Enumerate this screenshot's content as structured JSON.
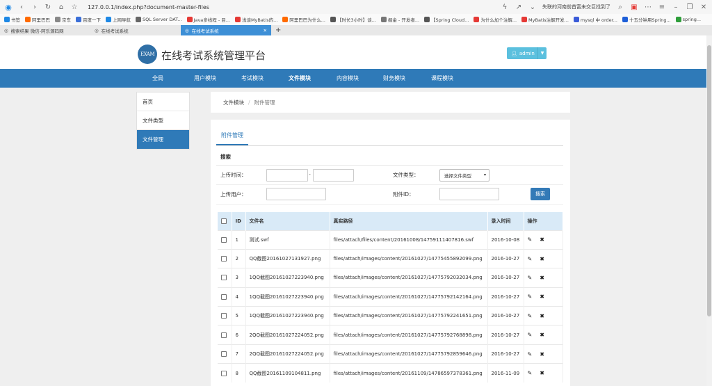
{
  "browser": {
    "url": "127.0.0.1/index.php?document-master-files",
    "news_text": "失联的河南前首富未交巨找到了",
    "bookmarks": [
      "书签",
      "阿里巴巴",
      "京东",
      "百度一下",
      "上网导航",
      "SQL Server DAT...",
      "Java多线程 - 目...",
      "浅谈MyBatis的...",
      "阿里巴巴为什么...",
      "【时长3小时】谈...",
      "掘金 - 开发者...",
      "【Spring Cloud...",
      "为什么加个注解...",
      "MyBatis注解开发...",
      "mysql 中 order...",
      "十五分钟用Spring...",
      "spring..."
    ],
    "tabs": [
      {
        "label": "搜索结果 微信-阿乐源码网",
        "active": false
      },
      {
        "label": "在线考试系统",
        "active": false
      },
      {
        "label": "在线考试系统",
        "active": true
      }
    ],
    "new_tab": "+"
  },
  "header": {
    "logo_text": "EXAM",
    "title": "在线考试系统管理平台",
    "user": "admin"
  },
  "nav": {
    "items": [
      "全局",
      "用户模块",
      "考试模块",
      "文件模块",
      "内容模块",
      "财务模块",
      "课程模块"
    ],
    "active": "文件模块"
  },
  "sidebar": {
    "items": [
      "首页",
      "文件类型",
      "文件管理"
    ],
    "active": "文件管理"
  },
  "breadcrumb": {
    "parent": "文件模块",
    "separator": "/",
    "current": "附件管理"
  },
  "panel": {
    "tab": "附件管理",
    "search_title": "搜索",
    "upload_time_label": "上传时间：",
    "range_sep": "-",
    "file_type_label": "文件类型：",
    "file_type_select": "选择文件类型",
    "upload_user_label": "上传用户：",
    "attach_id_label": "附件ID：",
    "search_button": "搜索"
  },
  "table": {
    "headers": [
      "",
      "ID",
      "文件名",
      "真实路径",
      "录入时间",
      "操作"
    ],
    "rows": [
      {
        "id": "1",
        "name": "测试.swf",
        "path": "files/attach/files/content/20161008/14759111407816.swf",
        "date": "2016-10-08"
      },
      {
        "id": "2",
        "name": "QQ截图20161027131927.png",
        "path": "files/attach/images/content/20161027/14775455892099.png",
        "date": "2016-10-27"
      },
      {
        "id": "3",
        "name": "1QQ截图20161027223940.png",
        "path": "files/attach/images/content/20161027/14775792032034.png",
        "date": "2016-10-27"
      },
      {
        "id": "4",
        "name": "1QQ截图20161027223940.png",
        "path": "files/attach/images/content/20161027/14775792142164.png",
        "date": "2016-10-27"
      },
      {
        "id": "5",
        "name": "1QQ截图20161027223940.png",
        "path": "files/attach/images/content/20161027/14775792241651.png",
        "date": "2016-10-27"
      },
      {
        "id": "6",
        "name": "2QQ截图20161027224052.png",
        "path": "files/attach/images/content/20161027/14775792768898.png",
        "date": "2016-10-27"
      },
      {
        "id": "7",
        "name": "2QQ截图20161027224052.png",
        "path": "files/attach/images/content/20161027/14775792859646.png",
        "date": "2016-10-27"
      },
      {
        "id": "8",
        "name": "QQ截图20161109104811.png",
        "path": "files/attach/images/content/20161109/14786597378361.png",
        "date": "2016-11-09"
      }
    ]
  },
  "colors": {
    "nav": "#2f7ab8",
    "header_row": "#d9eaf7",
    "user_button": "#5bc0de",
    "search_button": "#337ab7"
  }
}
